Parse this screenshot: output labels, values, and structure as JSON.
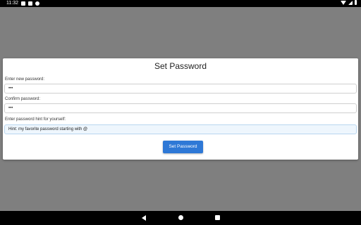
{
  "status_bar": {
    "time": "11:32",
    "icons": [
      "notification-icon",
      "app-icon",
      "vpn-icon",
      "wifi-icon",
      "signal-icon",
      "battery-icon"
    ]
  },
  "dialog": {
    "title": "Set Password",
    "new_password": {
      "label": "Enter new password:",
      "value": "•••"
    },
    "confirm_password": {
      "label": "Confirm password:",
      "value": "•••"
    },
    "hint": {
      "label": "Enter password hint for yourself:",
      "value": "Hint: my favorite password starting with @"
    },
    "submit_label": "Set Password"
  },
  "nav_bar": {
    "icons": [
      "back-icon",
      "home-icon",
      "recent-apps-icon"
    ]
  }
}
